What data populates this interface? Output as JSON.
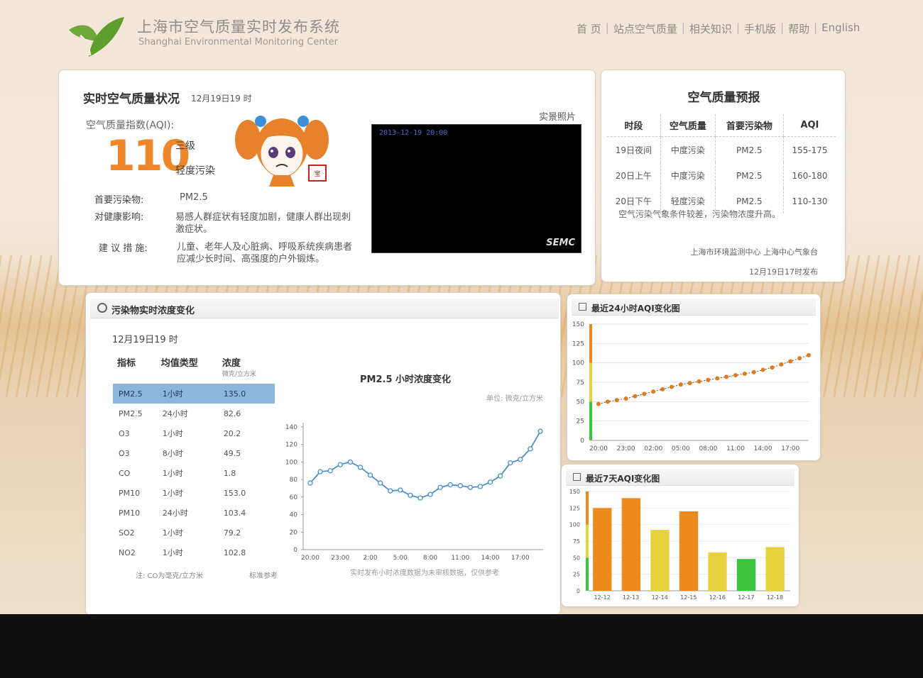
{
  "header": {
    "title_cn": "上海市空气质量实时发布系统",
    "title_en": "Shanghai Environmental Monitoring Center",
    "nav": [
      "首 页",
      "站点空气质量",
      "相关知识",
      "手机版",
      "帮助",
      "English"
    ]
  },
  "status": {
    "title": "实时空气质量状况",
    "time": "12月19日19 时",
    "aqi_label": "空气质量指数(AQI):",
    "aqi": "110",
    "level": "三级",
    "level_desc": "轻度污染",
    "primary_label": "首要污染物:",
    "primary_value": "PM2.5",
    "health_label": "对健康影响:",
    "health_text_1": "易感人群症状有轻度加剧，健康人群出现刺",
    "health_text_2": "激症状。",
    "advice_label": "建 议 措 施:",
    "advice_text_1": "儿童、老年人及心脏病、呼吸系统疾病患者",
    "advice_text_2": "应减少长时间、高强度的户外锻炼。",
    "photo_label": "实景照片",
    "photo_timestamp": "2013-12-19 20:00",
    "photo_watermark": "SEMC",
    "colors": {
      "aqi": "#f0862a"
    }
  },
  "forecast": {
    "title": "空气质量预报",
    "headers": [
      "时段",
      "空气质量",
      "首要污染物",
      "AQI"
    ],
    "rows": [
      [
        "19日夜间",
        "中度污染",
        "PM2.5",
        "155-175"
      ],
      [
        "20日上午",
        "中度污染",
        "PM2.5",
        "160-180"
      ],
      [
        "20日下午",
        "轻度污染",
        "PM2.5",
        "110-130"
      ]
    ],
    "note": "空气污染气象条件较差，污染物浓度升高。",
    "source": "上海市环境监测中心 上海中心气象台",
    "published": "12月19日17时发布"
  },
  "pollutants": {
    "title": "污染物实时浓度变化",
    "time": "12月19日19 时",
    "headers": [
      "指标",
      "均值类型",
      "浓度"
    ],
    "unit_sub": "微克/立方米",
    "rows": [
      [
        "PM2.5",
        "1小时",
        "135.0"
      ],
      [
        "PM2.5",
        "24小时",
        "82.6"
      ],
      [
        "O3",
        "1小时",
        "20.2"
      ],
      [
        "O3",
        "8小时",
        "49.5"
      ],
      [
        "CO",
        "1小时",
        "1.8"
      ],
      [
        "PM10",
        "1小时",
        "153.0"
      ],
      [
        "PM10",
        "24小时",
        "103.4"
      ],
      [
        "SO2",
        "1小时",
        "79.2"
      ],
      [
        "NO2",
        "1小时",
        "102.8"
      ]
    ],
    "footnote_1": "注: CO为毫克/立方米",
    "footnote_2": "标准参考",
    "footnote_3": "实时发布小时浓度数据为未审核数据，仅供参考"
  },
  "aqi24": {
    "title": "最近24小时AQI变化图"
  },
  "aqi7": {
    "title": "最近7天AQI变化图"
  },
  "chart_data": [
    {
      "type": "line",
      "title": "PM2.5 小时浓度变化",
      "unit": "单位: 微克/立方米",
      "x": [
        "20:00",
        "21:00",
        "22:00",
        "23:00",
        "00:00",
        "01:00",
        "02:00",
        "03:00",
        "04:00",
        "05:00",
        "06:00",
        "07:00",
        "08:00",
        "09:00",
        "10:00",
        "11:00",
        "12:00",
        "13:00",
        "14:00",
        "15:00",
        "16:00",
        "17:00",
        "18:00",
        "19:00"
      ],
      "xticks": [
        "20:00",
        "23:00",
        "2:00",
        "5:00",
        "8:00",
        "11:00",
        "14:00",
        "17:00"
      ],
      "values": [
        76,
        89,
        90,
        97,
        100,
        94,
        85,
        76,
        67,
        68,
        62,
        59,
        63,
        71,
        74,
        73,
        71,
        72,
        77,
        84,
        99,
        103,
        115,
        135
      ],
      "ylim": [
        0,
        140
      ],
      "yticks": [
        0,
        20,
        40,
        60,
        80,
        100,
        120,
        140
      ],
      "color": "#4a8fc9"
    },
    {
      "type": "line",
      "title": "最近24小时AQI变化图",
      "x": [
        "20:00",
        "21:00",
        "22:00",
        "23:00",
        "00:00",
        "01:00",
        "02:00",
        "03:00",
        "04:00",
        "05:00",
        "06:00",
        "07:00",
        "08:00",
        "09:00",
        "10:00",
        "11:00",
        "12:00",
        "13:00",
        "14:00",
        "15:00",
        "16:00",
        "17:00",
        "18:00",
        "19:00"
      ],
      "xticks": [
        "20:00",
        "23:00",
        "02:00",
        "05:00",
        "08:00",
        "11:00",
        "14:00",
        "17:00"
      ],
      "values": [
        47,
        50,
        52,
        54,
        57,
        60,
        63,
        66,
        69,
        72,
        74,
        76,
        78,
        80,
        82,
        84,
        86,
        88,
        91,
        94,
        98,
        102,
        106,
        110
      ],
      "ylim": [
        0,
        150
      ],
      "yticks": [
        0,
        25,
        50,
        75,
        100,
        125,
        150
      ],
      "color": "#e07a1f"
    },
    {
      "type": "bar",
      "title": "最近7天AQI变化图",
      "categories": [
        "12-12",
        "12-13",
        "12-14",
        "12-15",
        "12-16",
        "12-17",
        "12-18"
      ],
      "values": [
        125,
        140,
        92,
        120,
        58,
        48,
        66
      ],
      "colors": [
        "#ee8a1c",
        "#ee8a1c",
        "#e6d23a",
        "#ee8a1c",
        "#e6d23a",
        "#3cc43c",
        "#e6d23a"
      ],
      "ylim": [
        0,
        150
      ],
      "yticks": [
        0,
        25,
        50,
        75,
        100,
        125,
        150
      ]
    }
  ]
}
